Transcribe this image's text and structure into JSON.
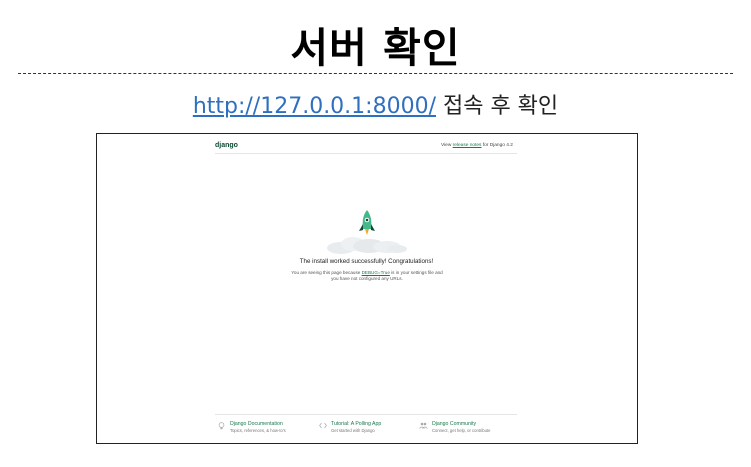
{
  "slide": {
    "title": "서버 확인",
    "url": "http://127.0.0.1:8000/",
    "subtitle_suffix": " 접속 후 확인"
  },
  "django_page": {
    "logo": "django",
    "top_note_prefix": "View ",
    "top_note_link": "release notes",
    "top_note_suffix": " for Django 4.2",
    "headline": "The install worked successfully! Congratulations!",
    "body_prefix": "You are seeing this page because ",
    "body_link": "DEBUG=True",
    "body_suffix": " is in your settings file and you have not configured any URLs.",
    "footer": [
      {
        "title": "Django Documentation",
        "desc": "Topics, references, & how-to's",
        "icon": "lightbulb-icon"
      },
      {
        "title": "Tutorial: A Polling App",
        "desc": "Get started with Django",
        "icon": "code-icon"
      },
      {
        "title": "Django Community",
        "desc": "Connect, get help, or contribute",
        "icon": "people-icon"
      }
    ]
  },
  "colors": {
    "django_green": "#0c4b33",
    "link_green": "#1a7a4c",
    "rocket_teal": "#44b78b",
    "url_blue": "#2f6fbf"
  }
}
